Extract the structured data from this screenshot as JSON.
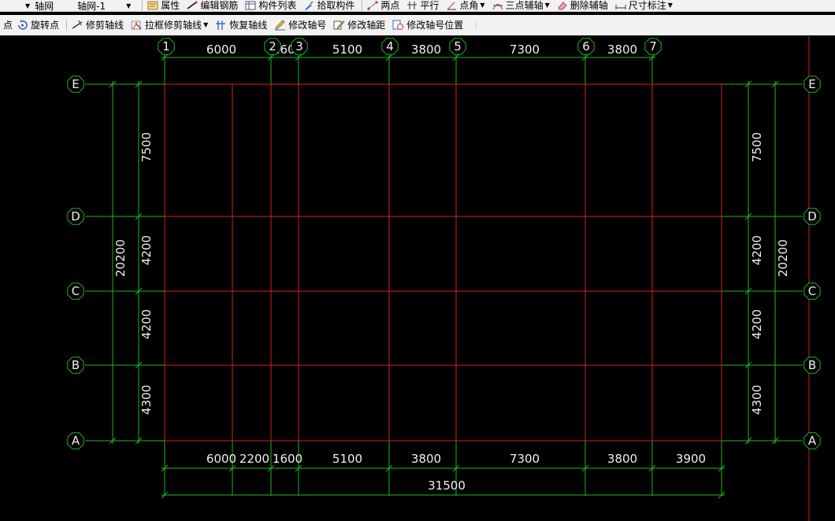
{
  "toolbar1": {
    "combo_type": "轴网",
    "combo_name": "轴网-1",
    "items": [
      "属性",
      "编辑钢筋",
      "构件列表",
      "拾取构件",
      "两点",
      "平行",
      "点角",
      "三点辅轴",
      "删除辅轴",
      "尺寸标注"
    ]
  },
  "toolbar2": {
    "partial_label": "点",
    "items": [
      "旋转点",
      "修剪轴线",
      "拉框修剪轴线",
      "恢复轴线",
      "修改轴号",
      "修改轴距",
      "修改轴号位置"
    ]
  },
  "colors": {
    "background": "#000000",
    "axis_line": "#d81e1e",
    "dimension_line": "#1fb31f",
    "text": "#f0f0f0",
    "toolbar_bg": "#f2f2f2"
  },
  "grid": {
    "vertical_axes": [
      "1",
      "2",
      "3",
      "4",
      "5",
      "6",
      "7"
    ],
    "horizontal_axes": [
      "E",
      "D",
      "C",
      "B",
      "A"
    ],
    "top_spacings": [
      "6000",
      "1600",
      "5100",
      "3800",
      "7300",
      "3800"
    ],
    "bottom_spacings": [
      "6000",
      "2200",
      "1600",
      "5100",
      "3800",
      "7300",
      "3800",
      "3900"
    ],
    "bottom_total": "31500",
    "left_spacings": [
      "7500",
      "4200",
      "4200",
      "4300"
    ],
    "left_total": "20200",
    "right_spacings": [
      "7500",
      "4200",
      "4200",
      "4300"
    ],
    "right_total": "20200"
  }
}
